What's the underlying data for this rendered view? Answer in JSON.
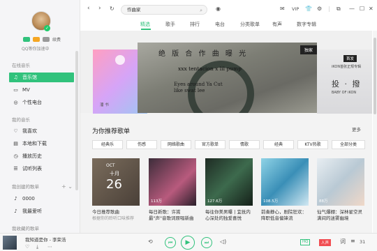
{
  "sidebar": {
    "vip_text": "续费",
    "qq_note": "QQ等你加速中",
    "section_online": "在线音乐",
    "online_items": [
      {
        "label": "音乐馆",
        "icon": "music-hall-icon"
      },
      {
        "label": "MV",
        "icon": "mv-icon"
      },
      {
        "label": "个性电台",
        "icon": "radio-icon"
      }
    ],
    "section_my": "我的音乐",
    "my_items": [
      {
        "label": "我喜欢",
        "icon": "heart-icon"
      },
      {
        "label": "本地和下载",
        "icon": "local-download-icon"
      },
      {
        "label": "播放历史",
        "icon": "history-icon"
      },
      {
        "label": "试听列表",
        "icon": "trial-list-icon"
      }
    ],
    "section_created": "我创建的歌单",
    "created_items": [
      {
        "label": "0000",
        "icon": "playlist-icon"
      },
      {
        "label": "我最爱听",
        "icon": "playlist-icon"
      }
    ],
    "section_fav": "我收藏的歌单"
  },
  "topbar": {
    "search_value": "作曲家",
    "vip_label": "VIP"
  },
  "tabs": [
    "精选",
    "歌手",
    "排行",
    "电台",
    "分类歌单",
    "有声",
    "数字专辑"
  ],
  "active_tab": "精选",
  "banner": {
    "main_title": "绝 版 合 作 曲 曝 光",
    "main_tag": "独家",
    "main_subtitle": "xxx tentacion x lil pump",
    "main_scribble": "Eyes around Ya Cut like swat lee",
    "left_text": "潘 书",
    "right_tag": "首发",
    "right_text": "iKON首张正规专辑",
    "right_title": "投 · 撥",
    "right_sub": "BABY OF iKON"
  },
  "recommend": {
    "title": "为你推荐歌单",
    "more": "更多",
    "categories": [
      "经典乐",
      "伤感",
      "网络歌曲",
      "官方歌单",
      "情歌",
      "经典",
      "KTV热歌",
      "全部分类"
    ]
  },
  "cards": [
    {
      "title": "今日推荐歌曲",
      "subtitle": "根据你的聆听口味推荐",
      "count": "",
      "cal_month": "OCT",
      "cal_cn": "十月",
      "cal_day": "26"
    },
    {
      "title": "每日新歌：许嵩最\"声\"音歌词原唱新曲",
      "count": "113万"
    },
    {
      "title": "每往你美男曝 | 宜抚内心深处的独爱喜悦",
      "count": "127.6万"
    },
    {
      "title": "前奏静心，剧院狂欢：降职低音偏锋流",
      "count": "108.5万"
    },
    {
      "title": "仙气爆棚：深林星空灵满间的迷雾幽境",
      "count": "88万"
    }
  ],
  "player": {
    "song": "我知道是你 - 李荣浩",
    "hq": "HQ",
    "red_badge": "人声",
    "lyric": "词",
    "count": "31"
  },
  "colors": {
    "accent": "#31c27c"
  }
}
